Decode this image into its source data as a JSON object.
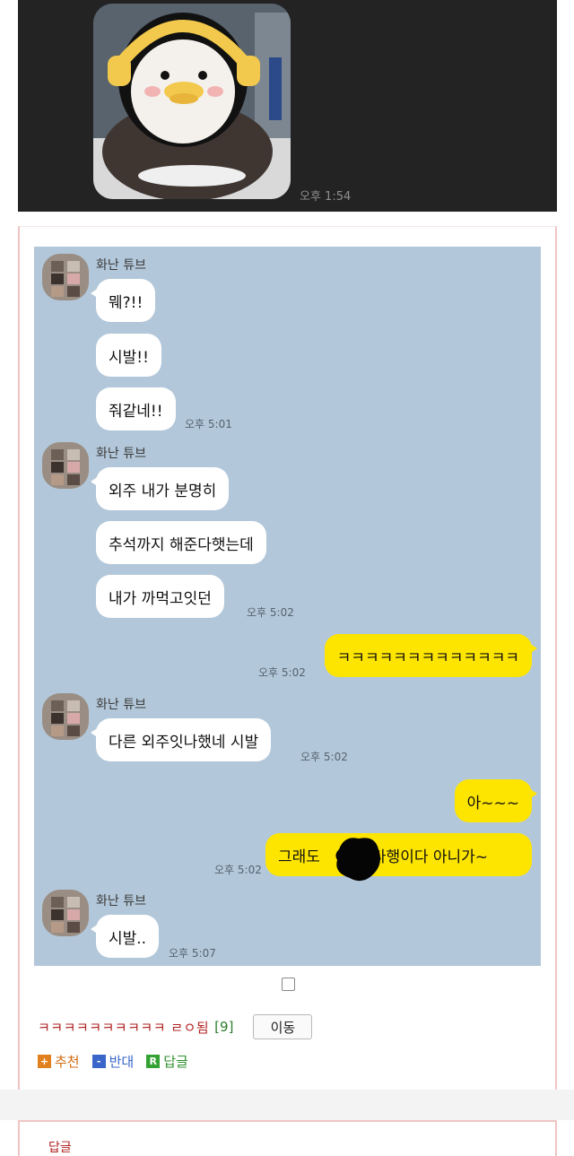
{
  "top_image": {
    "time": "오후 1:54"
  },
  "chat": {
    "groups": [
      {
        "sender": "화난 튜브",
        "messages": [
          "뭬?!!",
          "시발!!",
          "줘같네!!"
        ],
        "time": "오후 5:01"
      },
      {
        "sender": "화난 튜브",
        "messages": [
          "외주 내가 분명히",
          "추석까지 해준다햇는데",
          "내가 까먹고잇던"
        ],
        "time": "오후 5:02"
      },
      {
        "sent": [
          "ㅋㅋㅋㅋㅋㅋㅋㅋㅋㅋㅋㅋㅋ"
        ],
        "time": "오후 5:02"
      },
      {
        "sender": "화난 튜브",
        "messages": [
          "다른 외주잇나했네 시발"
        ],
        "time": "오후 5:02"
      },
      {
        "sent": [
          "아~~~",
          "그래도 다행이다 아니가~"
        ],
        "sent_prefix": "그래도",
        "sent_suffix": "다행이다 아니가~",
        "time": "오후 5:02"
      },
      {
        "sender": "화난 튜브",
        "messages": [
          "시발.."
        ],
        "time": "오후 5:07"
      }
    ]
  },
  "post": {
    "title": "ㅋㅋㅋㅋㅋㅋㅋㅋㅋㅋ ㄹㅇ됨",
    "reply_count": "[9]",
    "move_label": "이동"
  },
  "actions": {
    "recommend": {
      "icon": "+",
      "label": "추천"
    },
    "oppose": {
      "icon": "-",
      "label": "반대"
    },
    "reply": {
      "icon": "R",
      "label": "답글"
    }
  },
  "bottom": {
    "label": "답글"
  },
  "colors": {
    "chat_bg": "#b2c7d9",
    "sent_bubble": "#fee500",
    "recv_bubble": "#ffffff",
    "card_border": "#f1c5c5"
  }
}
